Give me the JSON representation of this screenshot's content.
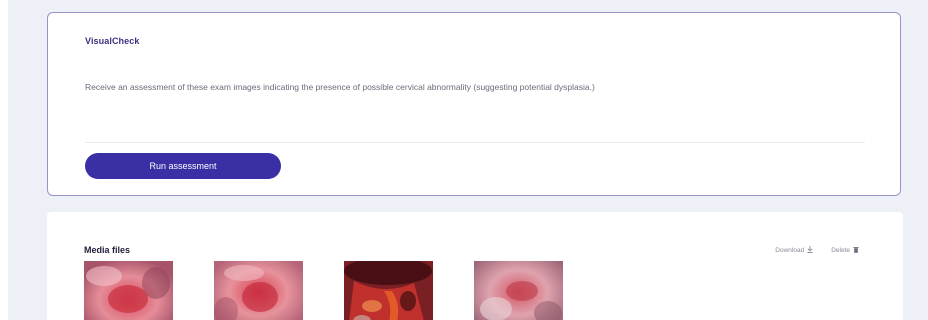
{
  "visualcheck": {
    "title": "VisualCheck",
    "description": "Receive an assessment of these exam images indicating the presence of possible cervical abnormality (suggesting potential dysplasia.)",
    "run_button_label": "Run assessment"
  },
  "media": {
    "title": "Media files",
    "download_label": "Download",
    "delete_label": "Delete",
    "download_icon": "download-icon",
    "delete_icon": "trash-icon",
    "thumbnails": [
      {
        "name": "exam-image-1"
      },
      {
        "name": "exam-image-2"
      },
      {
        "name": "exam-image-3"
      },
      {
        "name": "exam-image-4"
      }
    ]
  },
  "colors": {
    "accent": "#3a2fa5",
    "card_border": "#9b93c7",
    "background": "#edf0f6"
  }
}
